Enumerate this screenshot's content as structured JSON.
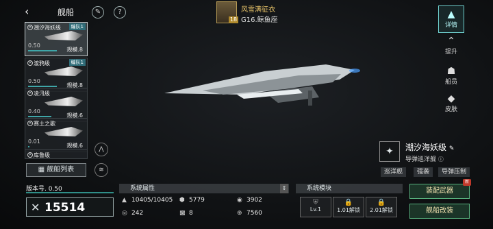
{
  "header": {
    "back_icon": "chevron-left",
    "title": "舰船",
    "commander": {
      "name": "风雪满征衣",
      "level": "18",
      "location": "G16.鲸鱼座"
    }
  },
  "ship_list": [
    {
      "name": "潮汐海妖级",
      "tag": "编队1",
      "value": "0.50",
      "progress": 0.5,
      "scale": "规模.8",
      "selected": true
    },
    {
      "name": "渡鸦级",
      "tag": "编队1",
      "value": "0.50",
      "progress": 0.5,
      "scale": "规模.8",
      "selected": false
    },
    {
      "name": "凌汛级",
      "tag": "",
      "value": "0.40",
      "progress": 0.4,
      "scale": "规模.6",
      "selected": false
    },
    {
      "name": "赛土之歌",
      "tag": "",
      "value": "0.01",
      "progress": 0.01,
      "scale": "规模.6",
      "selected": false
    },
    {
      "name": "库鲁级",
      "tag": "",
      "value": "",
      "progress": 0,
      "scale": "",
      "selected": false
    }
  ],
  "list_button": "舰船列表",
  "right_nav": [
    {
      "label": "详情",
      "icon": "ship-detail-icon",
      "selected": true
    },
    {
      "label": "提升",
      "icon": "upgrade-icon",
      "selected": false
    },
    {
      "label": "船员",
      "icon": "crew-icon",
      "selected": false
    },
    {
      "label": "皮肤",
      "icon": "skin-icon",
      "selected": false
    }
  ],
  "ship": {
    "name": "潮汐海妖级",
    "type": "导弹巡洋舰",
    "chips": [
      "巡洋舰",
      "强袭",
      "导弹压制"
    ]
  },
  "version": "版本号. 0.50",
  "power": "15514",
  "attributes": {
    "heading": "系统属性",
    "items": [
      {
        "icon": "hull-icon",
        "value": "10405/10405"
      },
      {
        "icon": "armor-icon",
        "value": "5779"
      },
      {
        "icon": "shield-icon",
        "value": "3902"
      },
      {
        "icon": "speed-icon",
        "value": "242"
      },
      {
        "icon": "grid-icon",
        "value": "8"
      },
      {
        "icon": "target-icon",
        "value": "7560"
      }
    ]
  },
  "modules": {
    "heading": "系统模块",
    "items": [
      {
        "label": "Lv.1",
        "icon": "module-shield-icon"
      },
      {
        "label": "1.01解锁",
        "icon": "lock-icon"
      },
      {
        "label": "2.01解锁",
        "icon": "lock-icon"
      }
    ]
  },
  "actions": {
    "equip": "装配武器",
    "modify": "舰船改装",
    "new_badge": "新"
  }
}
